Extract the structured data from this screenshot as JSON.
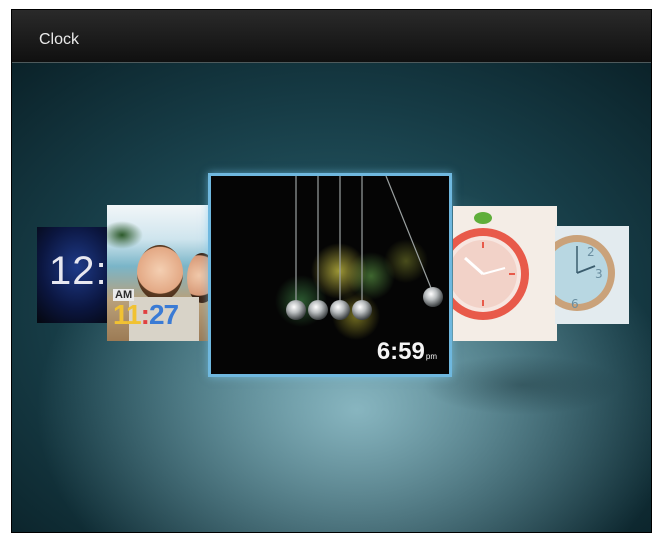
{
  "header": {
    "title": "Clock"
  },
  "carousel": {
    "items": [
      {
        "name": "dark-digital-clock",
        "time_text": "12:"
      },
      {
        "name": "beach-photo-clock",
        "period": "AM",
        "hour": "11",
        "minute": "27"
      },
      {
        "name": "newtons-cradle-clock",
        "time_text": "6:59",
        "period": "pm",
        "selected": true
      },
      {
        "name": "apple-analog-clock"
      },
      {
        "name": "wooden-analog-clock"
      }
    ]
  },
  "colors": {
    "selection_border": "#6fb8df",
    "background": "#1f4d58",
    "topbar": "#1a1a1a"
  }
}
